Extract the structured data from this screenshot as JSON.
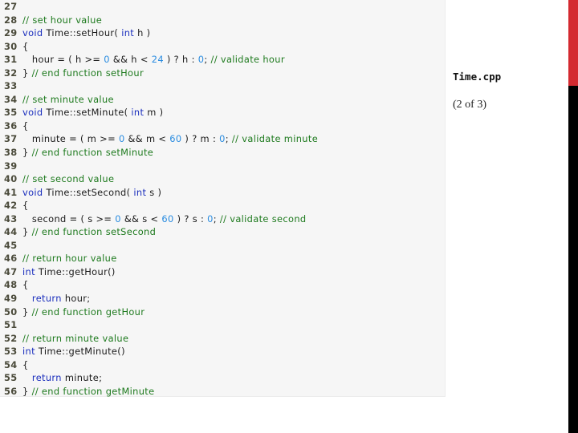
{
  "file_label": "Time.cpp",
  "part_label": "(2 of 3)",
  "colors": {
    "keyword": "#1a2ebd",
    "comment": "#1e7a1e",
    "number": "#2a8ce0",
    "text": "#1a1a1a",
    "accent_red": "#d42a30",
    "accent_black": "#000000"
  },
  "code_lines": [
    {
      "n": "27",
      "tokens": []
    },
    {
      "n": "28",
      "tokens": [
        {
          "t": "cm",
          "v": "// set hour value"
        }
      ]
    },
    {
      "n": "29",
      "tokens": [
        {
          "t": "kw",
          "v": "void"
        },
        {
          "t": "tx",
          "v": " Time::setHour( "
        },
        {
          "t": "kw",
          "v": "int"
        },
        {
          "t": "tx",
          "v": " h )"
        }
      ]
    },
    {
      "n": "30",
      "tokens": [
        {
          "t": "tx",
          "v": "{"
        }
      ]
    },
    {
      "n": "31",
      "tokens": [
        {
          "t": "tx",
          "v": "   hour = ( h >= "
        },
        {
          "t": "num",
          "v": "0"
        },
        {
          "t": "tx",
          "v": " && h < "
        },
        {
          "t": "num",
          "v": "24"
        },
        {
          "t": "tx",
          "v": " ) ? h : "
        },
        {
          "t": "num",
          "v": "0"
        },
        {
          "t": "tx",
          "v": "; "
        },
        {
          "t": "cm",
          "v": "// validate hour"
        }
      ]
    },
    {
      "n": "32",
      "tokens": [
        {
          "t": "tx",
          "v": "} "
        },
        {
          "t": "cm",
          "v": "// end function setHour"
        }
      ]
    },
    {
      "n": "33",
      "tokens": []
    },
    {
      "n": "34",
      "tokens": [
        {
          "t": "cm",
          "v": "// set minute value"
        }
      ]
    },
    {
      "n": "35",
      "tokens": [
        {
          "t": "kw",
          "v": "void"
        },
        {
          "t": "tx",
          "v": " Time::setMinute( "
        },
        {
          "t": "kw",
          "v": "int"
        },
        {
          "t": "tx",
          "v": " m )"
        }
      ]
    },
    {
      "n": "36",
      "tokens": [
        {
          "t": "tx",
          "v": "{"
        }
      ]
    },
    {
      "n": "37",
      "tokens": [
        {
          "t": "tx",
          "v": "   minute = ( m >= "
        },
        {
          "t": "num",
          "v": "0"
        },
        {
          "t": "tx",
          "v": " && m < "
        },
        {
          "t": "num",
          "v": "60"
        },
        {
          "t": "tx",
          "v": " ) ? m : "
        },
        {
          "t": "num",
          "v": "0"
        },
        {
          "t": "tx",
          "v": "; "
        },
        {
          "t": "cm",
          "v": "// validate minute"
        }
      ]
    },
    {
      "n": "38",
      "tokens": [
        {
          "t": "tx",
          "v": "} "
        },
        {
          "t": "cm",
          "v": "// end function setMinute"
        }
      ]
    },
    {
      "n": "39",
      "tokens": []
    },
    {
      "n": "40",
      "tokens": [
        {
          "t": "cm",
          "v": "// set second value"
        }
      ]
    },
    {
      "n": "41",
      "tokens": [
        {
          "t": "kw",
          "v": "void"
        },
        {
          "t": "tx",
          "v": " Time::setSecond( "
        },
        {
          "t": "kw",
          "v": "int"
        },
        {
          "t": "tx",
          "v": " s )"
        }
      ]
    },
    {
      "n": "42",
      "tokens": [
        {
          "t": "tx",
          "v": "{"
        }
      ]
    },
    {
      "n": "43",
      "tokens": [
        {
          "t": "tx",
          "v": "   second = ( s >= "
        },
        {
          "t": "num",
          "v": "0"
        },
        {
          "t": "tx",
          "v": " && s < "
        },
        {
          "t": "num",
          "v": "60"
        },
        {
          "t": "tx",
          "v": " ) ? s : "
        },
        {
          "t": "num",
          "v": "0"
        },
        {
          "t": "tx",
          "v": "; "
        },
        {
          "t": "cm",
          "v": "// validate second"
        }
      ]
    },
    {
      "n": "44",
      "tokens": [
        {
          "t": "tx",
          "v": "} "
        },
        {
          "t": "cm",
          "v": "// end function setSecond"
        }
      ]
    },
    {
      "n": "45",
      "tokens": []
    },
    {
      "n": "46",
      "tokens": [
        {
          "t": "cm",
          "v": "// return hour value"
        }
      ]
    },
    {
      "n": "47",
      "tokens": [
        {
          "t": "kw",
          "v": "int"
        },
        {
          "t": "tx",
          "v": " Time::getHour()"
        }
      ]
    },
    {
      "n": "48",
      "tokens": [
        {
          "t": "tx",
          "v": "{"
        }
      ]
    },
    {
      "n": "49",
      "tokens": [
        {
          "t": "tx",
          "v": "   "
        },
        {
          "t": "kw",
          "v": "return"
        },
        {
          "t": "tx",
          "v": " hour;"
        }
      ]
    },
    {
      "n": "50",
      "tokens": [
        {
          "t": "tx",
          "v": "} "
        },
        {
          "t": "cm",
          "v": "// end function getHour"
        }
      ]
    },
    {
      "n": "51",
      "tokens": []
    },
    {
      "n": "52",
      "tokens": [
        {
          "t": "cm",
          "v": "// return minute value"
        }
      ]
    },
    {
      "n": "53",
      "tokens": [
        {
          "t": "kw",
          "v": "int"
        },
        {
          "t": "tx",
          "v": " Time::getMinute()"
        }
      ]
    },
    {
      "n": "54",
      "tokens": [
        {
          "t": "tx",
          "v": "{"
        }
      ]
    },
    {
      "n": "55",
      "tokens": [
        {
          "t": "tx",
          "v": "   "
        },
        {
          "t": "kw",
          "v": "return"
        },
        {
          "t": "tx",
          "v": " minute;"
        }
      ]
    },
    {
      "n": "56",
      "tokens": [
        {
          "t": "tx",
          "v": "} "
        },
        {
          "t": "cm",
          "v": "// end function getMinute"
        }
      ]
    }
  ]
}
